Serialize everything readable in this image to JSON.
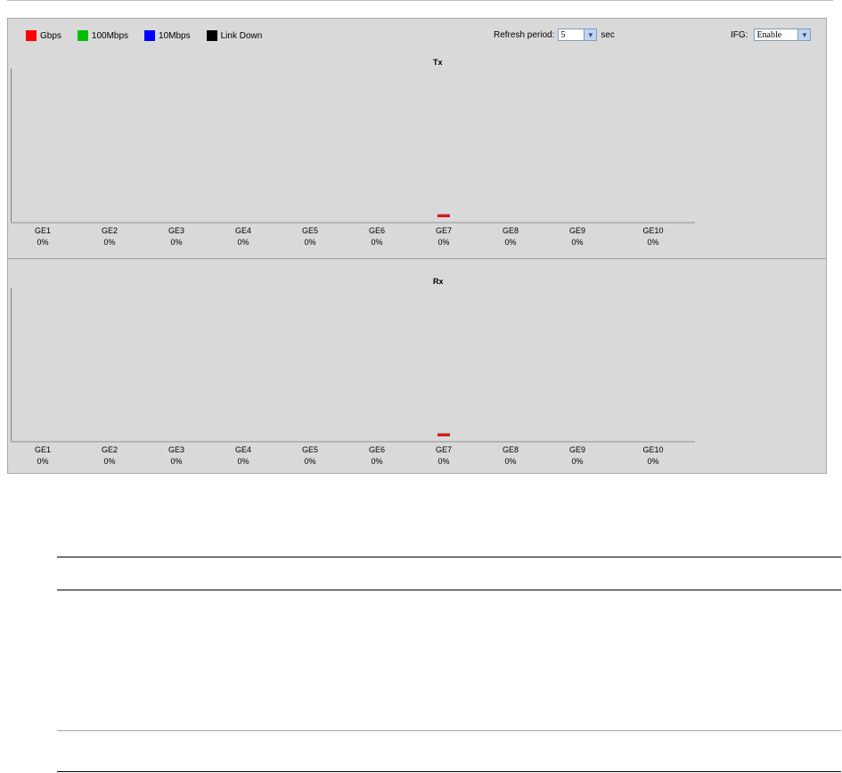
{
  "legend": [
    {
      "label": "Gbps",
      "color": "#ff0000"
    },
    {
      "label": "100Mbps",
      "color": "#00c000"
    },
    {
      "label": "10Mbps",
      "color": "#0000ff"
    },
    {
      "label": "Link Down",
      "color": "#000000"
    }
  ],
  "refresh": {
    "label": "Refresh period:",
    "value": "5",
    "unit": "sec"
  },
  "ifg": {
    "label": "IFG:",
    "value": "Enable"
  },
  "graphs": [
    {
      "title": "Tx",
      "ports": [
        {
          "name": "GE1",
          "pct": "0%"
        },
        {
          "name": "GE2",
          "pct": "0%"
        },
        {
          "name": "GE3",
          "pct": "0%"
        },
        {
          "name": "GE4",
          "pct": "0%"
        },
        {
          "name": "GE5",
          "pct": "0%"
        },
        {
          "name": "GE6",
          "pct": "0%"
        },
        {
          "name": "GE7",
          "pct": "0%"
        },
        {
          "name": "GE8",
          "pct": "0%"
        },
        {
          "name": "GE9",
          "pct": "0%"
        },
        {
          "name": "GE10",
          "pct": "0%"
        }
      ]
    },
    {
      "title": "Rx",
      "ports": [
        {
          "name": "GE1",
          "pct": "0%"
        },
        {
          "name": "GE2",
          "pct": "0%"
        },
        {
          "name": "GE3",
          "pct": "0%"
        },
        {
          "name": "GE4",
          "pct": "0%"
        },
        {
          "name": "GE5",
          "pct": "0%"
        },
        {
          "name": "GE6",
          "pct": "0%"
        },
        {
          "name": "GE7",
          "pct": "0%"
        },
        {
          "name": "GE8",
          "pct": "0%"
        },
        {
          "name": "GE9",
          "pct": "0%"
        },
        {
          "name": "GE10",
          "pct": "0%"
        }
      ]
    }
  ]
}
